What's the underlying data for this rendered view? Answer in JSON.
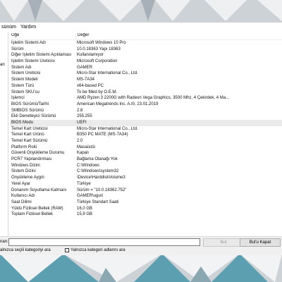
{
  "menu": {
    "items": [
      "sünüm",
      "Yardım"
    ]
  },
  "tree": {
    "label": "an"
  },
  "columns": {
    "item": "Öğe",
    "value": "Değer"
  },
  "rows": [
    {
      "item": "İşletim Sistemi Adı",
      "value": "Microsoft Windows 10 Pro"
    },
    {
      "item": "Sürüm",
      "value": "10.0.18363 Yapı 18363"
    },
    {
      "item": "Diğer İşletim Sistemi Açıklaması",
      "value": "Kullanılamıyor"
    },
    {
      "item": "İşletim Sistemi Üreticisi",
      "value": "Microsoft Corporation"
    },
    {
      "item": "Sistem Adı",
      "value": "GAMER"
    },
    {
      "item": "Sistem Üreticisi",
      "value": "Micro-Star International Co., Ltd."
    },
    {
      "item": "Sistem Modeli",
      "value": "MS-7A34"
    },
    {
      "item": "Sistem Türü",
      "value": "x64-based PC"
    },
    {
      "item": "Sistem SKU'su",
      "value": "To be filled by O.E.M."
    },
    {
      "item": "İşlemci",
      "value": "AMD Ryzen 3 2200G with Radeon Vega Graphics, 3500 Mhz, 4 Çekirdek, 4 Ma..."
    },
    {
      "item": "BIOS Sürümü/Tarihi",
      "value": "American Megatrends Inc. A.I0, 23.01.2019"
    },
    {
      "item": "SMBIOS Sürümü",
      "value": "2.8"
    },
    {
      "item": "Ekli Denetleyici Sürümü",
      "value": "255.255"
    },
    {
      "item": "BIOS Modu",
      "value": "UEFI"
    },
    {
      "item": "Temel Kart Üreticisi",
      "value": "Micro-Star International Co., Ltd."
    },
    {
      "item": "Temel Kart Ürünü",
      "value": "B350 PC MATE (MS-7A34)"
    },
    {
      "item": "Temel Kart Sürümü",
      "value": "2.0"
    },
    {
      "item": "Platform Rolü",
      "value": "Masaüstü"
    },
    {
      "item": "Güvenli Önyükleme Durumu",
      "value": "Kapalı"
    },
    {
      "item": "PCR7 Yapılandırması",
      "value": "Bağlama Olanağı Yok"
    },
    {
      "item": "Windows Dizini",
      "value": "C:\\Windows"
    },
    {
      "item": "Sistem Dizini",
      "value": "C:\\Windows\\system32"
    },
    {
      "item": "Önyükleme Aygıtı",
      "value": "\\Device\\HarddiskVolume3"
    },
    {
      "item": "Yerel Ayar",
      "value": "Türkiye"
    },
    {
      "item": "Donanım Soyutlama Katmanı",
      "value": "Sürüm = \"10.0.18362.752\""
    },
    {
      "item": "Kullanıcı Adı",
      "value": "GAMER\\uguri"
    },
    {
      "item": "Saat Dilimi",
      "value": "Türkiye Standart Saati"
    },
    {
      "item": "Yüklü Fiziksel Bellek (RAM)",
      "value": "16,0 GB"
    },
    {
      "item": "Toplam Fiziksel Bellek",
      "value": "15,9 GB"
    }
  ],
  "selected_index": 13,
  "search": {
    "label": "nan:",
    "value": "",
    "find_button": "Bul",
    "close_button": "Bul'u Kapat",
    "check_selected_only": "alnızca seçili kategoriyi ara",
    "check_category_names_only": "Yalnızca kategori adlarını ara"
  },
  "colors": {
    "background": "#cfd4d9",
    "window": "#ffffff",
    "selected_row": "#ebebeb"
  }
}
